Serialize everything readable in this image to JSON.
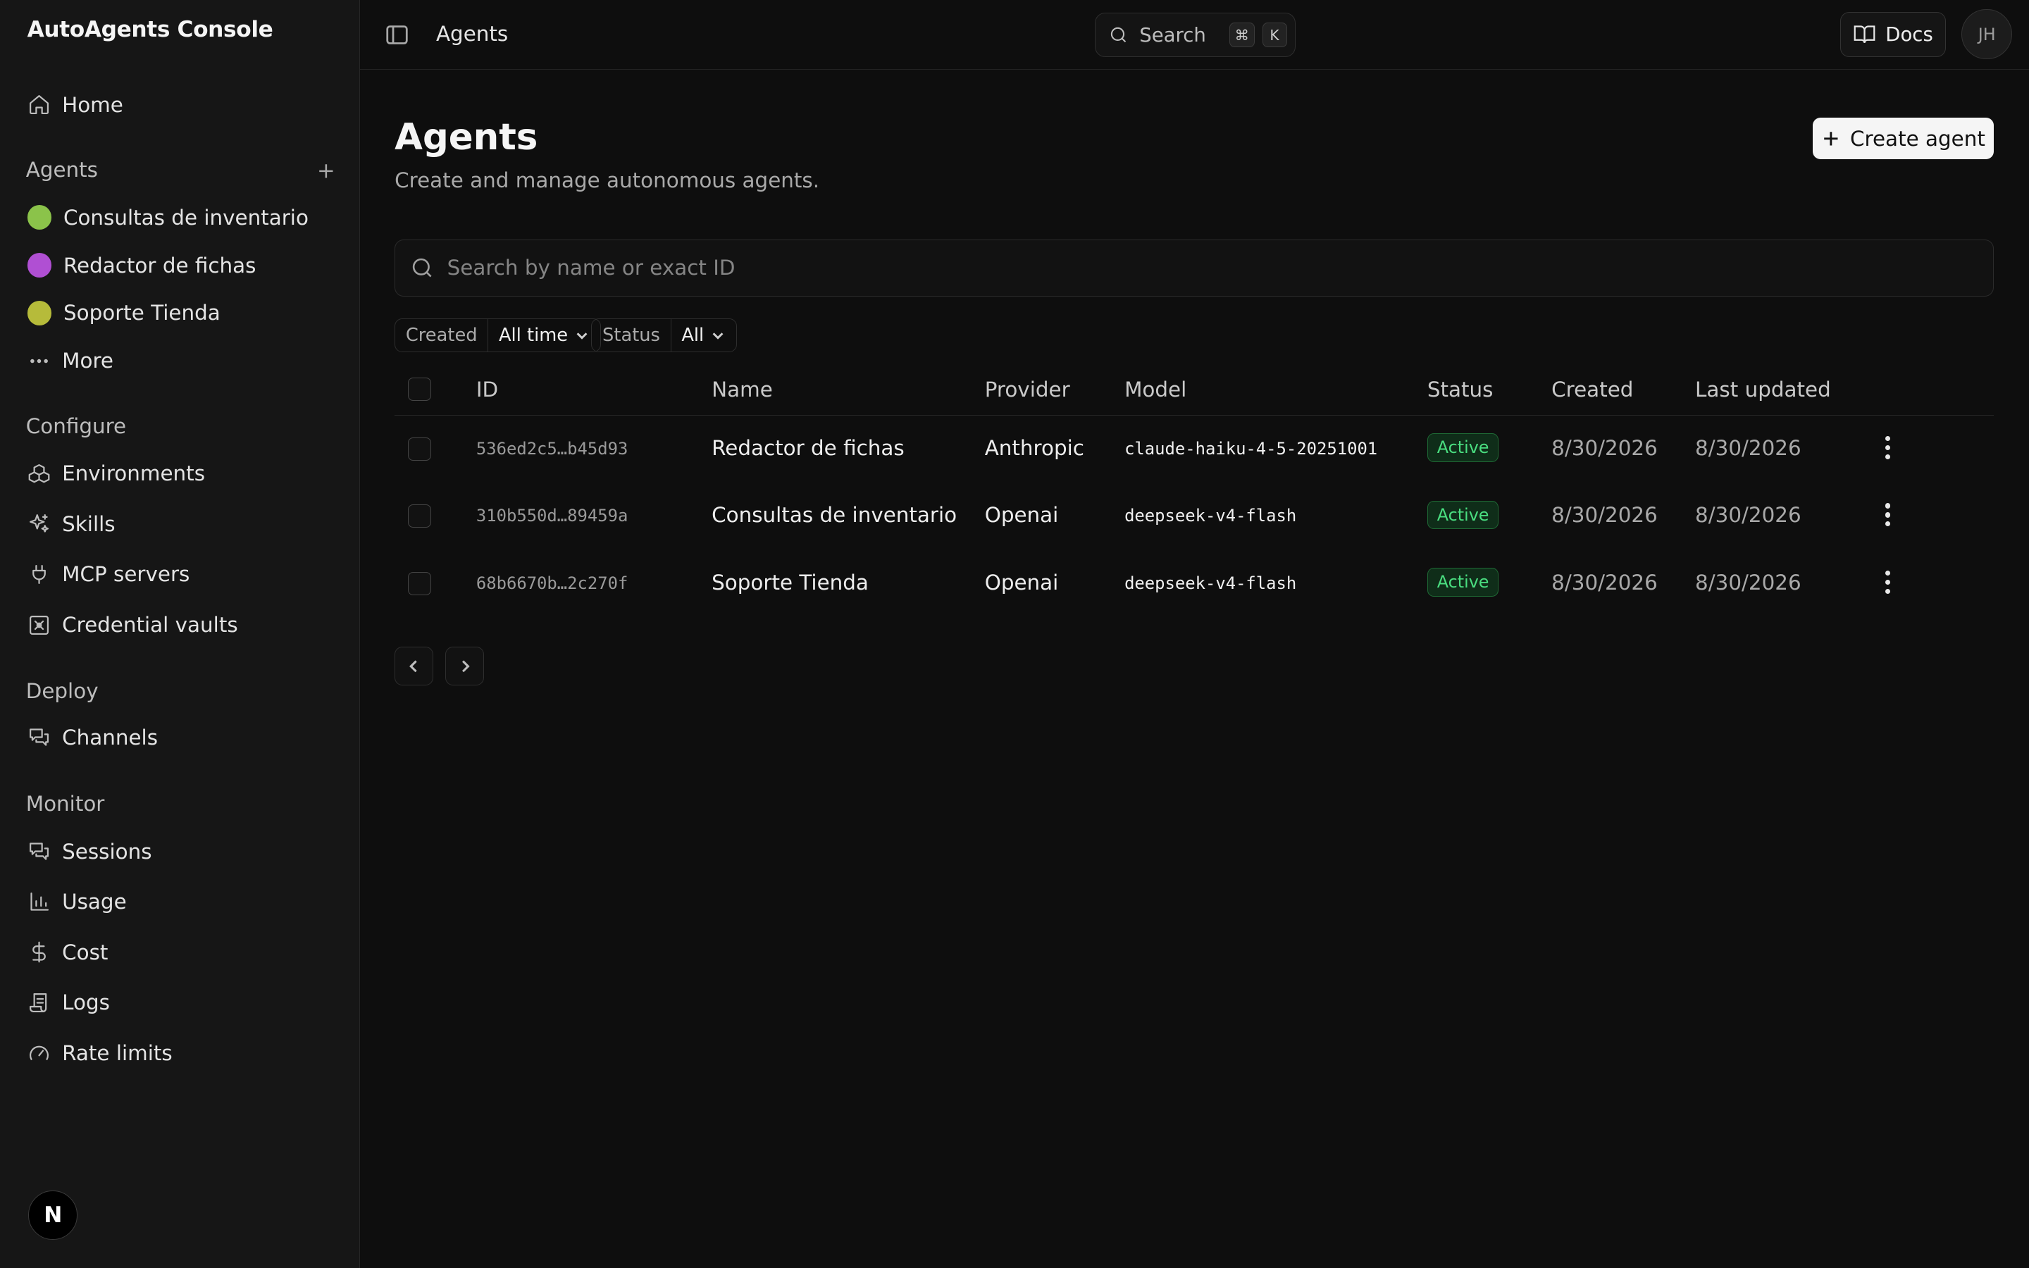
{
  "app": {
    "title": "AutoAgents Console"
  },
  "sidebar": {
    "home": "Home",
    "agents_label": "Agents",
    "agents": [
      {
        "label": "Consultas de inventario",
        "color": "#8bc34a"
      },
      {
        "label": "Redactor de fichas",
        "color": "#b04fd3"
      },
      {
        "label": "Soporte Tienda",
        "color": "#b6bb3a"
      }
    ],
    "more": "More",
    "configure_label": "Configure",
    "configure": [
      {
        "label": "Environments",
        "icon": "cubes-icon"
      },
      {
        "label": "Skills",
        "icon": "sparkles-icon"
      },
      {
        "label": "MCP servers",
        "icon": "plug-icon"
      },
      {
        "label": "Credential vaults",
        "icon": "vault-icon"
      }
    ],
    "deploy_label": "Deploy",
    "deploy": [
      {
        "label": "Channels",
        "icon": "chat-bubbles-icon"
      }
    ],
    "monitor_label": "Monitor",
    "monitor": [
      {
        "label": "Sessions",
        "icon": "chat-bubbles-icon"
      },
      {
        "label": "Usage",
        "icon": "bar-chart-icon"
      },
      {
        "label": "Cost",
        "icon": "dollar-icon"
      },
      {
        "label": "Logs",
        "icon": "scroll-icon"
      },
      {
        "label": "Rate limits",
        "icon": "gauge-icon"
      }
    ],
    "footer_badge": "N"
  },
  "topbar": {
    "breadcrumb": "Agents",
    "search_label": "Search",
    "search_kbd": [
      "⌘",
      "K"
    ],
    "docs_label": "Docs",
    "avatar_initials": "JH"
  },
  "page": {
    "title": "Agents",
    "subtitle": "Create and manage autonomous agents.",
    "create_button": "Create agent",
    "search_placeholder": "Search by name or exact ID",
    "filters": [
      {
        "key": "Created",
        "value": "All time"
      },
      {
        "key": "Status",
        "value": "All"
      }
    ]
  },
  "table": {
    "columns": [
      "ID",
      "Name",
      "Provider",
      "Model",
      "Status",
      "Created",
      "Last updated"
    ],
    "rows": [
      {
        "id": "536ed2c5…b45d93",
        "name": "Redactor de fichas",
        "provider": "Anthropic",
        "model": "claude-haiku-4-5-20251001",
        "status": "Active",
        "created": "8/30/2026",
        "updated": "8/30/2026"
      },
      {
        "id": "310b550d…89459a",
        "name": "Consultas de inventario",
        "provider": "Openai",
        "model": "deepseek-v4-flash",
        "status": "Active",
        "created": "8/30/2026",
        "updated": "8/30/2026"
      },
      {
        "id": "68b6670b…2c270f",
        "name": "Soporte Tienda",
        "provider": "Openai",
        "model": "deepseek-v4-flash",
        "status": "Active",
        "created": "8/30/2026",
        "updated": "8/30/2026"
      }
    ]
  },
  "colors": {
    "status_active": "#4ade80",
    "background": "#0e0e0e",
    "sidebar": "#161616"
  }
}
